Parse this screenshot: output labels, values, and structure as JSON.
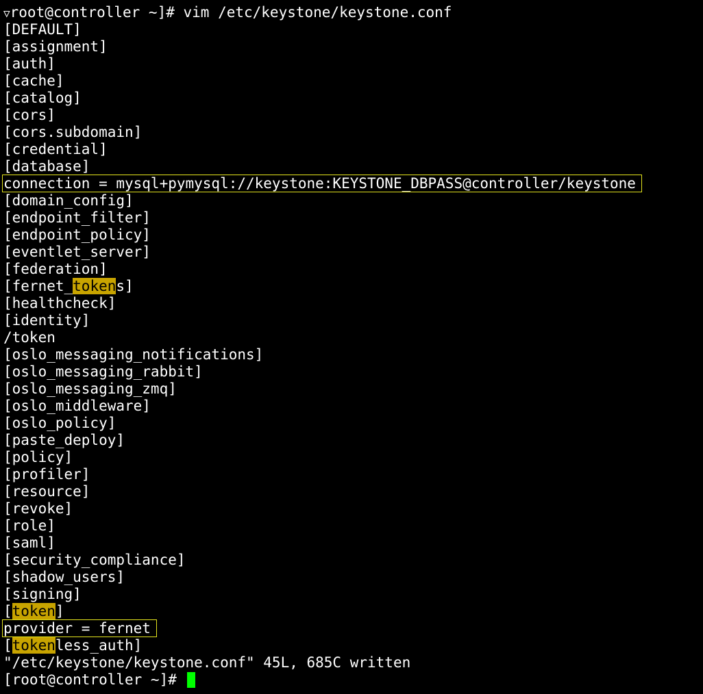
{
  "terminal": {
    "prompt_glyph": "▽",
    "command_line": "root@controller ~]# vim /etc/keystone/keystone.conf",
    "lines": [
      "[DEFAULT]",
      "[assignment]",
      "[auth]",
      "[cache]",
      "[catalog]",
      "[cors]",
      "[cors.subdomain]",
      "[credential]",
      "[database]"
    ],
    "connection_line": "connection = mysql+pymysql://keystone:KEYSTONE_DBPASS@controller/keystone",
    "lines2": [
      "[domain_config]",
      "[endpoint_filter]",
      "[endpoint_policy]",
      "[eventlet_server]",
      "[federation]"
    ],
    "fernet_pre": "[fernet_",
    "fernet_hl": "token",
    "fernet_post": "s]",
    "lines3": [
      "[healthcheck]",
      "[identity]",
      "/token",
      "[oslo_messaging_notifications]",
      "[oslo_messaging_rabbit]",
      "[oslo_messaging_zmq]",
      "[oslo_middleware]",
      "[oslo_policy]",
      "[paste_deploy]",
      "[policy]",
      "[profiler]",
      "[resource]",
      "[revoke]",
      "[role]",
      "[saml]",
      "[security_compliance]",
      "[shadow_users]",
      "[signing]"
    ],
    "token_pre": "[",
    "token_hl": "token",
    "token_post": "]",
    "provider_line": "provider = fernet",
    "tokenless_pre": "[",
    "tokenless_hl": "token",
    "tokenless_post": "less_auth]",
    "status_line": "\"/etc/keystone/keystone.conf\" 45L, 685C written",
    "final_prompt": "[root@controller ~]# ",
    "colors": {
      "background": "#000000",
      "text": "#ffffff",
      "search_highlight": "#c8a400",
      "box_outline": "#e6e61e",
      "cursor": "#00ff00"
    }
  }
}
